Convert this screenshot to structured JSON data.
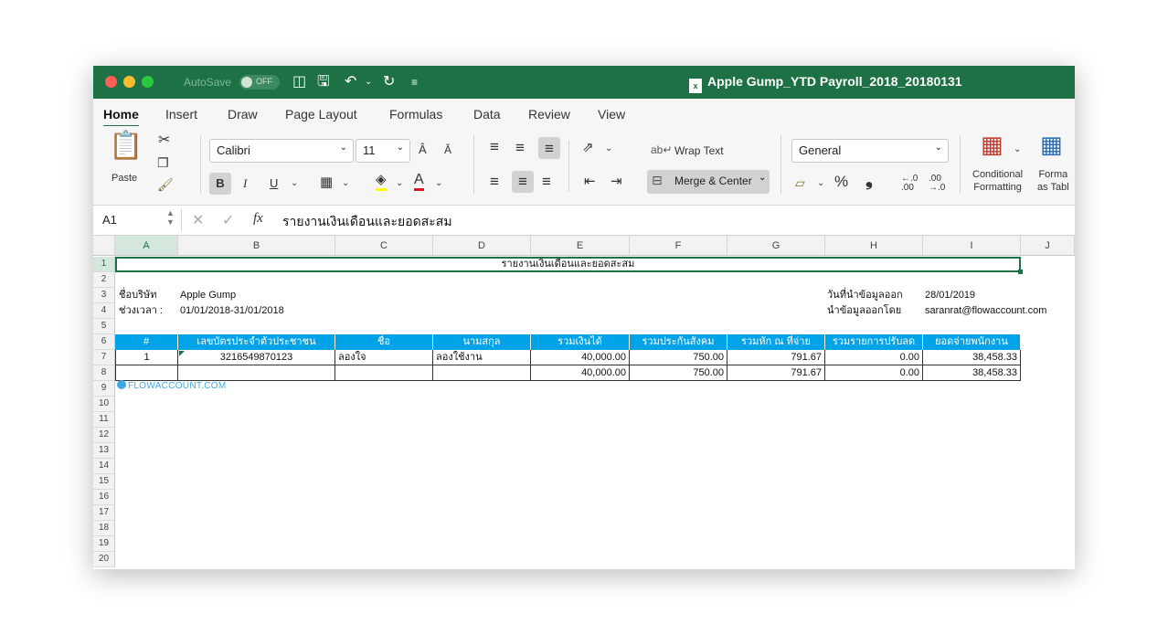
{
  "titlebar": {
    "autosave_label": "AutoSave",
    "autosave_state": "OFF",
    "file_title": "Apple Gump_YTD Payroll_2018_20180131",
    "file_icon": "x",
    "accent": "#1e7145"
  },
  "tabs": [
    "Home",
    "Insert",
    "Draw",
    "Page Layout",
    "Formulas",
    "Data",
    "Review",
    "View"
  ],
  "ribbon": {
    "paste_label": "Paste",
    "font_name": "Calibri",
    "font_size": "11",
    "bold": "B",
    "italic": "I",
    "underline": "U",
    "wrap_text": "Wrap Text",
    "merge_center": "Merge & Center",
    "number_format": "General",
    "percent": "%",
    "comma": "❟",
    "conditional_formatting": [
      "Conditional",
      "Formatting"
    ],
    "format_as_table": [
      "Forma",
      "as Tabl"
    ],
    "font_color": "#e81123",
    "highlight_color": "#ffff00"
  },
  "formula_bar": {
    "name_box": "A1",
    "fx": "fx",
    "content": "รายงานเงินเดือนและยอดสะสม"
  },
  "columns": [
    "A",
    "B",
    "C",
    "D",
    "E",
    "F",
    "G",
    "H",
    "I",
    "J"
  ],
  "rows": [
    "1",
    "2",
    "3",
    "4",
    "5",
    "6",
    "7",
    "8",
    "9",
    "10",
    "11",
    "12",
    "13",
    "14",
    "15",
    "16",
    "17",
    "18",
    "19",
    "20"
  ],
  "sheet": {
    "title": "รายงานเงินเดือนและยอดสะสม",
    "company_label": "ชื่อบริษัท",
    "company_value": "Apple Gump",
    "period_label": "ช่วงเวลา :",
    "period_value": "01/01/2018-31/01/2018",
    "export_date_label": "วันที่นำข้อมูลออก",
    "export_date_value": "28/01/2019",
    "exported_by_label": "นำข้อมูลออกโดย",
    "exported_by_value": "saranrat@flowaccount.com",
    "table_header": [
      "#",
      "เลขบัตรประจำตัวประชาชน",
      "ชื่อ",
      "นามสกุล",
      "รวมเงินได้",
      "รวมประกันสังคม",
      "รวมหัก ณ ที่จ่าย",
      "รวมรายการปรับลด",
      "ยอดจ่ายพนักงาน"
    ],
    "data_row": [
      "1",
      "3216549870123",
      "ลองใจ",
      "ลองใช้งาน",
      "40,000.00",
      "750.00",
      "791.67",
      "0.00",
      "38,458.33"
    ],
    "total_row": [
      "",
      "",
      "",
      "",
      "40,000.00",
      "750.00",
      "791.67",
      "0.00",
      "38,458.33"
    ],
    "watermark": "FLOWACCOUNT.COM",
    "header_color": "#00a2e8"
  }
}
